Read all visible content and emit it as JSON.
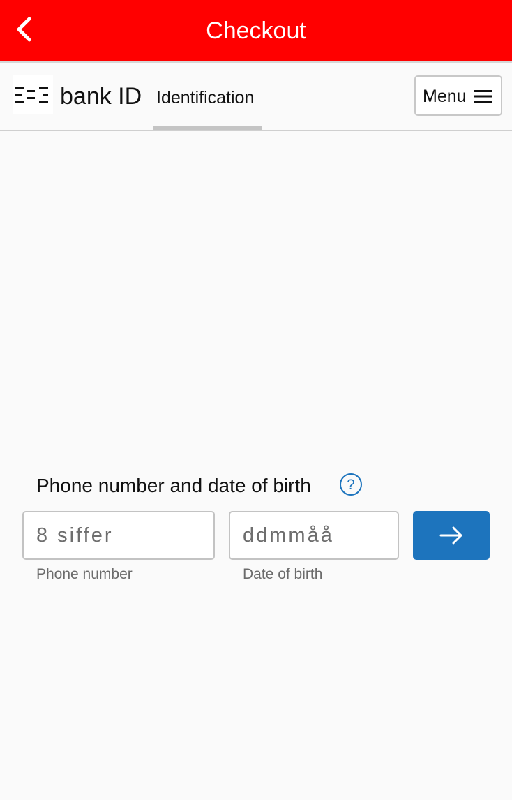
{
  "topbar": {
    "title": "Checkout",
    "back_icon": "chevron-left-icon",
    "background_color": "#ff0000"
  },
  "bankid": {
    "wordmark": "bank ID",
    "tab_label": "Identification",
    "menu_label": "Menu",
    "menu_icon": "hamburger-icon"
  },
  "form": {
    "label": "Phone number and date of birth",
    "help_icon": "question-circle-icon",
    "phone": {
      "placeholder": "8 siffer",
      "value": "",
      "caption": "Phone number"
    },
    "dob": {
      "placeholder": "ddmmåå",
      "value": "",
      "caption": "Date of birth"
    },
    "submit_icon": "arrow-right-icon",
    "accent_color": "#1d74bd"
  }
}
